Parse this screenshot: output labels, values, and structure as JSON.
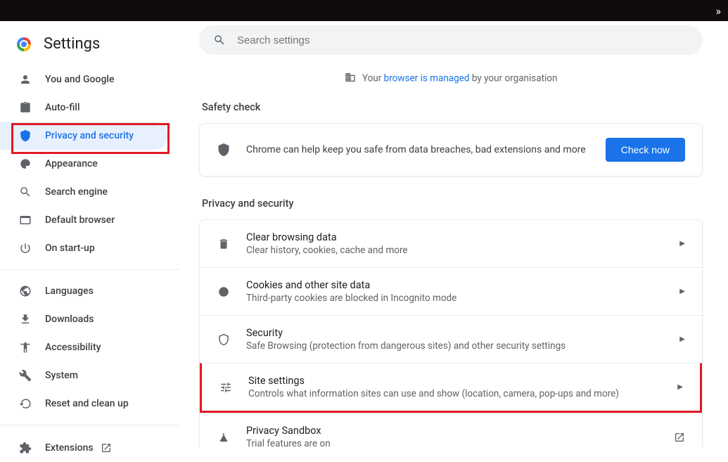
{
  "topbar": {
    "more_label": "»"
  },
  "header": {
    "title": "Settings"
  },
  "sidebar": {
    "items": [
      {
        "label": "You and Google"
      },
      {
        "label": "Auto-fill"
      },
      {
        "label": "Privacy and security"
      },
      {
        "label": "Appearance"
      },
      {
        "label": "Search engine"
      },
      {
        "label": "Default browser"
      },
      {
        "label": "On start-up"
      },
      {
        "label": "Languages"
      },
      {
        "label": "Downloads"
      },
      {
        "label": "Accessibility"
      },
      {
        "label": "System"
      },
      {
        "label": "Reset and clean up"
      }
    ],
    "extensions_label": "Extensions"
  },
  "search": {
    "placeholder": "Search settings"
  },
  "managed": {
    "prefix": "Your ",
    "link": "browser is managed",
    "suffix": " by your organisation"
  },
  "safety": {
    "section_title": "Safety check",
    "text": "Chrome can help keep you safe from data breaches, bad extensions and more",
    "button": "Check now"
  },
  "privacy": {
    "section_title": "Privacy and security",
    "rows": [
      {
        "title": "Clear browsing data",
        "subtitle": "Clear history, cookies, cache and more"
      },
      {
        "title": "Cookies and other site data",
        "subtitle": "Third-party cookies are blocked in Incognito mode"
      },
      {
        "title": "Security",
        "subtitle": "Safe Browsing (protection from dangerous sites) and other security settings"
      },
      {
        "title": "Site settings",
        "subtitle": "Controls what information sites can use and show (location, camera, pop-ups and more)"
      },
      {
        "title": "Privacy Sandbox",
        "subtitle": "Trial features are on"
      }
    ]
  }
}
